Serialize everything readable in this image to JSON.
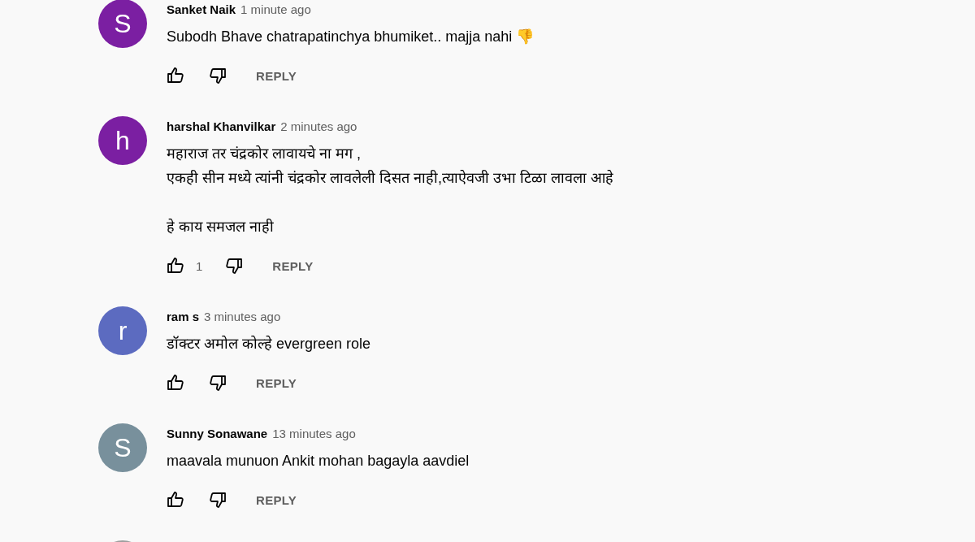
{
  "comments": [
    {
      "kind": "full",
      "avatar_letter": "S",
      "color": "#7b1fa2",
      "author": "Sanket Naik",
      "time": "1 minute ago",
      "paragraphs": [
        [
          "Subodh Bhave chatrapatinchya bhumiket.. majja nahi 👎"
        ]
      ],
      "reply": "REPLY"
    },
    {
      "kind": "full",
      "avatar_letter": "h",
      "color": "#7b1fa2",
      "author": "harshal Khanvilkar",
      "time": "2 minutes ago",
      "paragraphs": [
        [
          "महाराज तर चंद्रकोर लावायचे ना मग ,",
          "एकही सीन मध्ये त्यांनी चंद्रकोर लावलेली दिसत नाही,त्याऐवजी उभा टिळा लावला आहे"
        ],
        [
          "हे काय समजल नाही"
        ]
      ],
      "like_count": "1",
      "reply": "REPLY"
    },
    {
      "kind": "full",
      "avatar_letter": "r",
      "color": "#5c6bc0",
      "author": "ram s",
      "time": "3 minutes ago",
      "paragraphs": [
        [
          "डॉक्टर अमोल कोल्हे evergreen role"
        ]
      ],
      "reply": "REPLY"
    },
    {
      "kind": "full",
      "avatar_letter": "S",
      "color": "#78909c",
      "author": "Sunny Sonawane",
      "time": "13 minutes ago",
      "paragraphs": [
        [
          "maavala munuon Ankit mohan bagayla aavdiel"
        ]
      ],
      "reply": "REPLY"
    },
    {
      "kind": "partial",
      "color": "#9e9e9e"
    }
  ]
}
